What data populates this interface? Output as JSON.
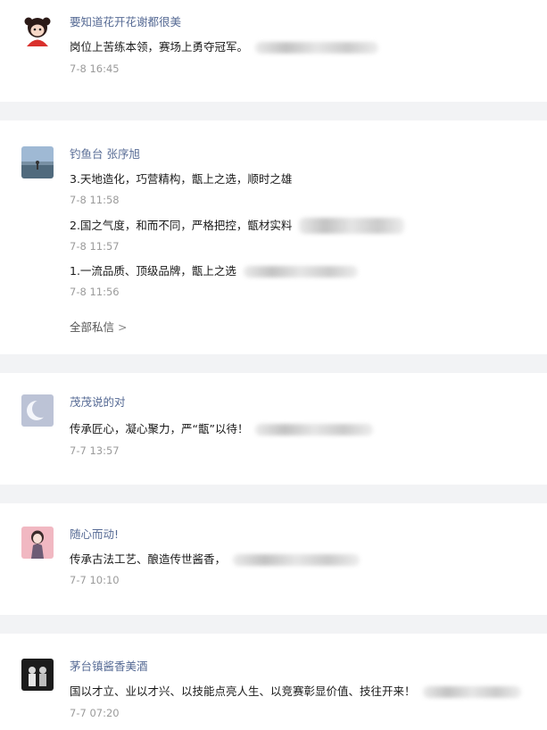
{
  "threads": [
    {
      "name": "要知道花开花谢都很美",
      "avatar_icon": "red-cartoon-girl-avatar-icon",
      "messages": [
        {
          "text": "岗位上苦练本领，赛场上勇夺冠军。",
          "time": "7-8 16:45"
        }
      ]
    },
    {
      "name": "钓鱼台 张序旭",
      "avatar_icon": "landscape-photo-avatar-icon",
      "messages": [
        {
          "text": "3.天地造化，巧营精构，甑上之选，顺时之雄",
          "time": "7-8 11:58"
        },
        {
          "text": "2.国之气度，和而不同，严格把控，甑材实料",
          "time": "7-8 11:57"
        },
        {
          "text": "1.一流品质、顶级品牌，甑上之选",
          "time": "7-8 11:56"
        }
      ],
      "more_link": "全部私信"
    },
    {
      "name": "茂茂说的对",
      "avatar_icon": "crescent-moon-avatar-icon",
      "messages": [
        {
          "text": "传承匠心，凝心聚力，严“甑”以待！",
          "time": "7-7 13:57"
        }
      ]
    },
    {
      "name": "随心而动!",
      "avatar_icon": "anime-character-avatar-icon",
      "messages": [
        {
          "text": "传承古法工艺、酿造传世酱香，",
          "time": "7-7 10:10"
        }
      ]
    },
    {
      "name": "茅台镇酱香美酒",
      "avatar_icon": "dark-group-photo-avatar-icon",
      "messages": [
        {
          "text": "国以才立、业以才兴、以技能点亮人生、以竞赛彰显价值、技往开来！",
          "time": "7-7 07:20"
        }
      ]
    }
  ]
}
